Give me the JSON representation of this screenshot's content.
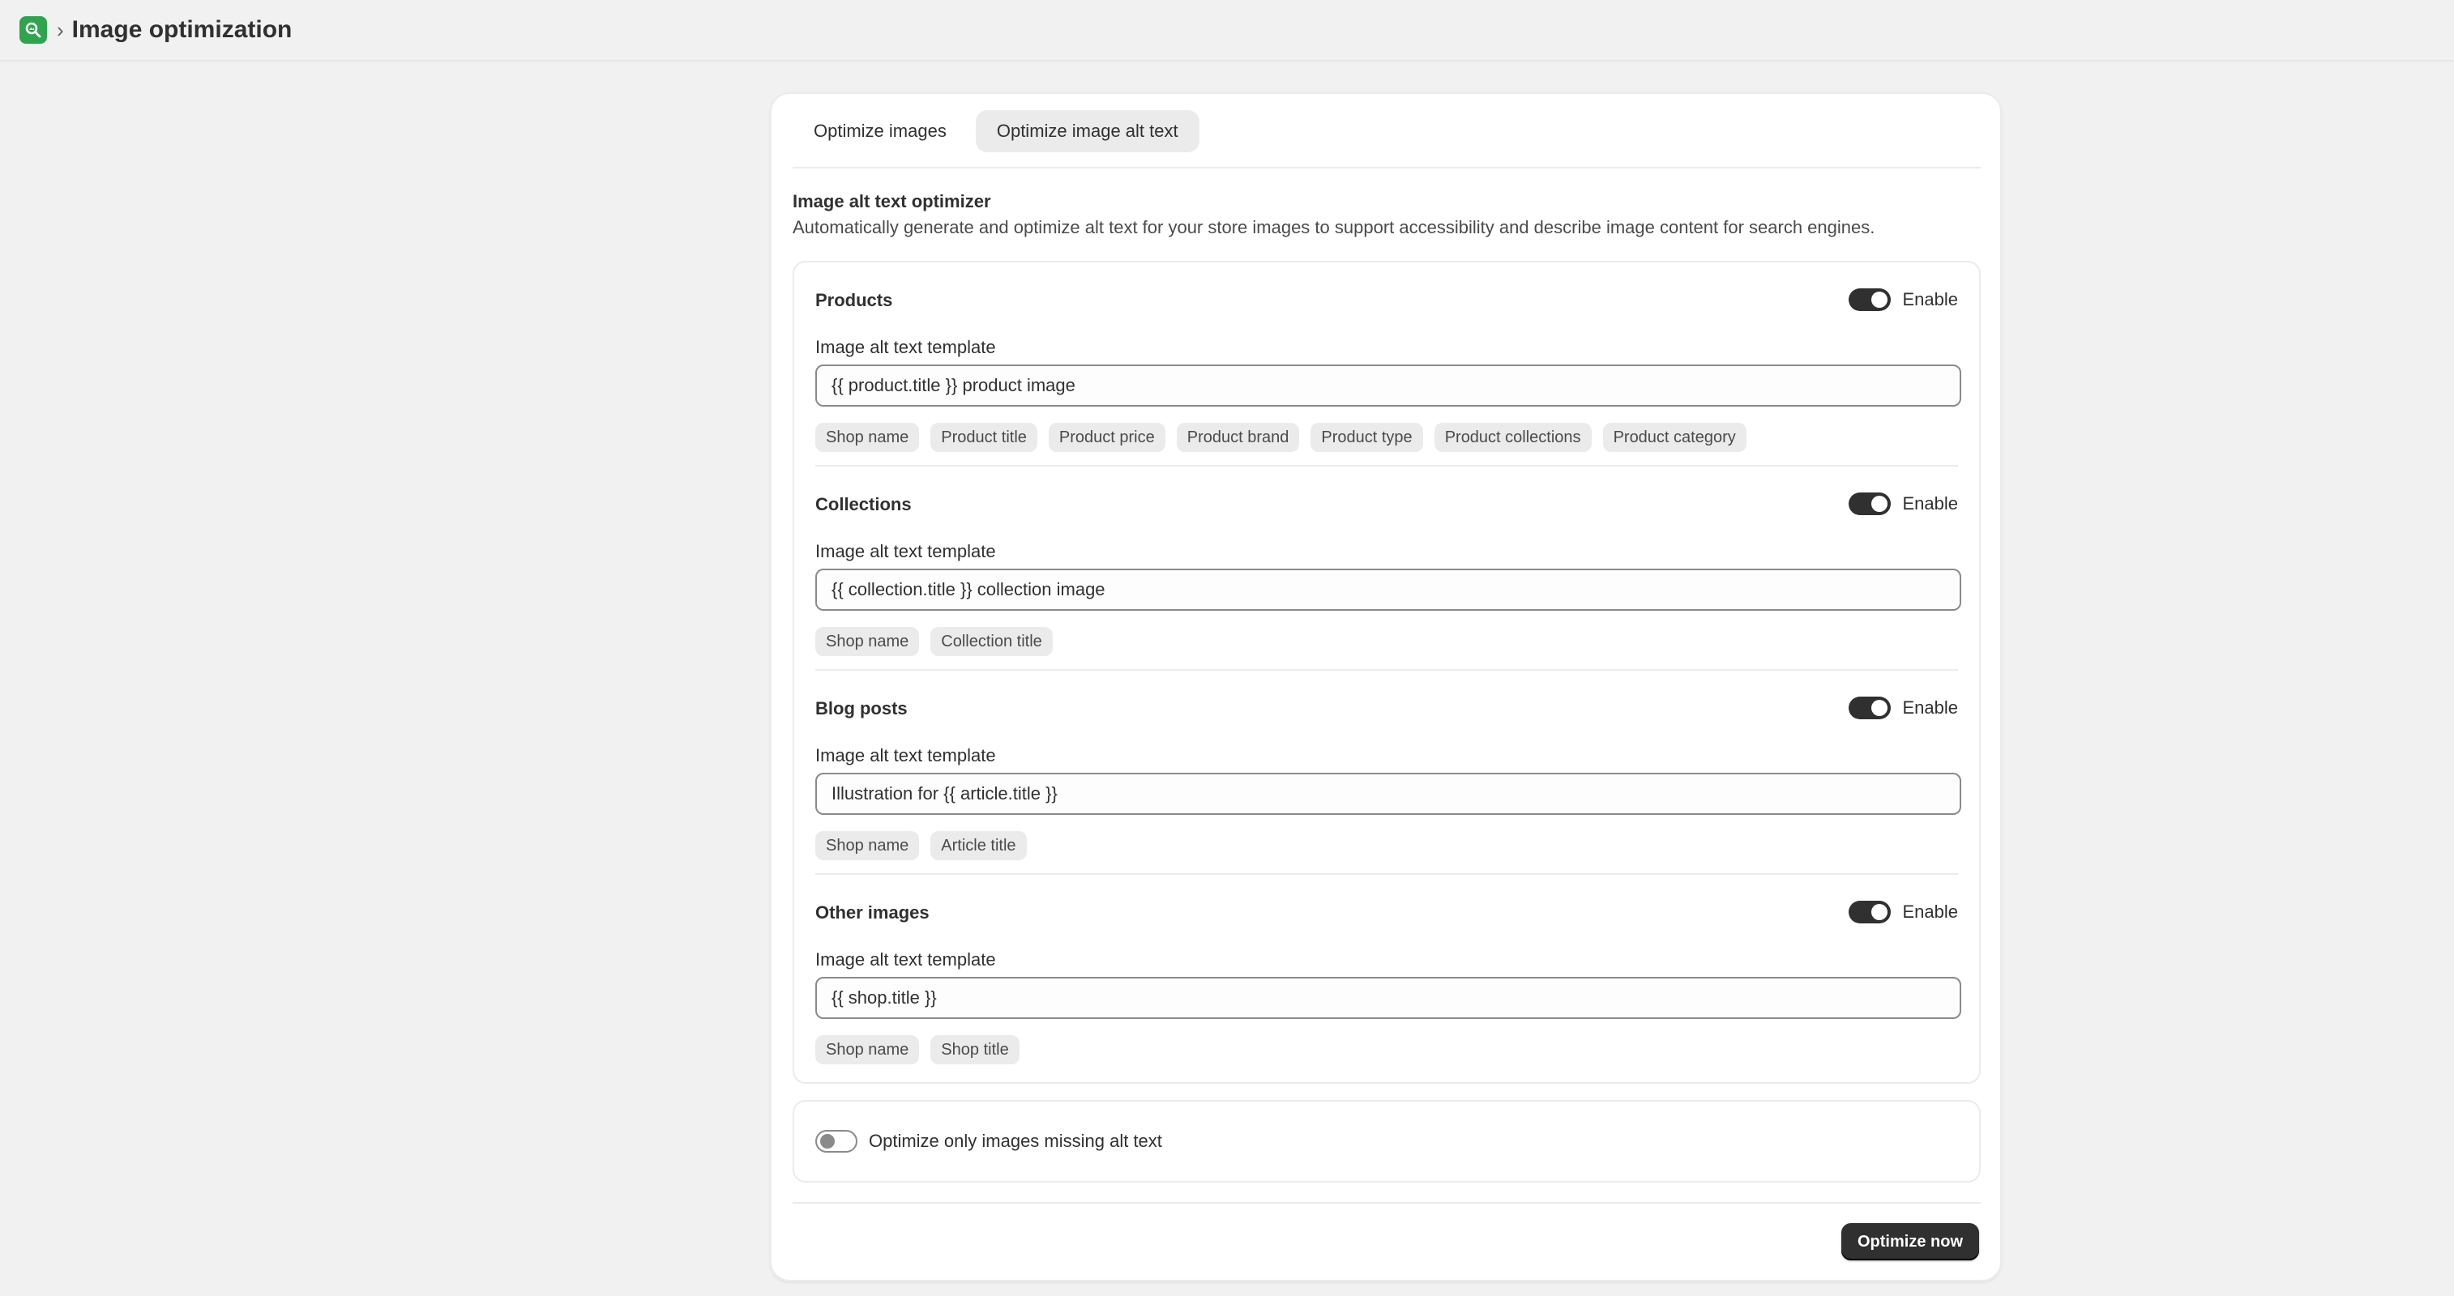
{
  "header": {
    "app_icon": "search-image-icon",
    "breadcrumb_separator": "›",
    "title": "Image optimization"
  },
  "tabs": [
    {
      "label": "Optimize images",
      "active": false
    },
    {
      "label": "Optimize image alt text",
      "active": true
    }
  ],
  "intro": {
    "title": "Image alt text optimizer",
    "description": "Automatically generate and optimize alt text for your store images to support accessibility and describe image content for search engines."
  },
  "sections": [
    {
      "title": "Products",
      "enabled": true,
      "toggle_label": "Enable",
      "field_label": "Image alt text template",
      "value": "{{ product.title }} product image",
      "chips": [
        "Shop name",
        "Product title",
        "Product price",
        "Product brand",
        "Product type",
        "Product collections",
        "Product category"
      ]
    },
    {
      "title": "Collections",
      "enabled": true,
      "toggle_label": "Enable",
      "field_label": "Image alt text template",
      "value": "{{ collection.title }} collection image",
      "chips": [
        "Shop name",
        "Collection title"
      ]
    },
    {
      "title": "Blog posts",
      "enabled": true,
      "toggle_label": "Enable",
      "field_label": "Image alt text template",
      "value": "Illustration for {{ article.title }}",
      "chips": [
        "Shop name",
        "Article title"
      ]
    },
    {
      "title": "Other images",
      "enabled": true,
      "toggle_label": "Enable",
      "field_label": "Image alt text template",
      "value": "{{ shop.title }}",
      "chips": [
        "Shop name",
        "Shop title"
      ]
    }
  ],
  "missing_only": {
    "label": "Optimize only images missing alt text",
    "enabled": false
  },
  "actions": {
    "optimize_label": "Optimize now"
  },
  "colors": {
    "page_bg": "#f1f1f1",
    "brand_green": "#2ea44f",
    "primary_button": "#303030"
  }
}
